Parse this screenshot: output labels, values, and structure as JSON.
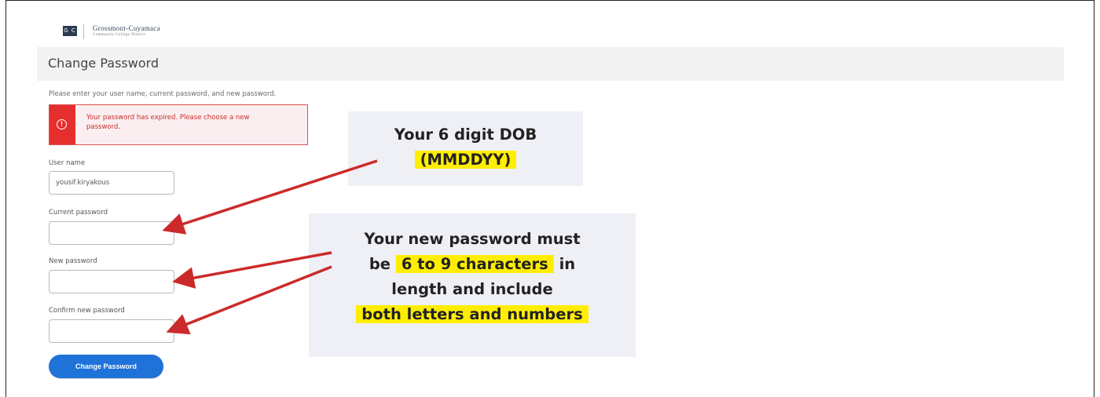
{
  "header": {
    "logo_mark": "G C",
    "org_name": "Grossmont-Cuyamaca",
    "org_subtitle": "Community College District"
  },
  "page": {
    "title": "Change Password",
    "instructions": "Please enter your user name, current password, and new password."
  },
  "alert": {
    "icon": "exclamation-circle-icon",
    "message": "Your password has expired. Please choose a new password.",
    "color": "#e52e2e"
  },
  "form": {
    "username_label": "User name",
    "username_value": "yousif.kiryakous",
    "current_password_label": "Current password",
    "current_password_value": "",
    "new_password_label": "New password",
    "new_password_value": "",
    "confirm_password_label": "Confirm new password",
    "confirm_password_value": "",
    "submit_label": "Change Password",
    "accent_color": "#1e72d8"
  },
  "callouts": {
    "dob": {
      "line1": "Your 6 digit DOB",
      "highlight": "(MMDDYY)"
    },
    "new_password": {
      "line1": "Your new password must",
      "line2_prefix": "be",
      "line2_highlight": "6 to 9 characters",
      "line2_suffix": "in",
      "line3": "length and include",
      "line4_highlight": "both letters and numbers"
    },
    "highlight_color": "#ffee00",
    "arrow_color": "#cc2a2a"
  }
}
